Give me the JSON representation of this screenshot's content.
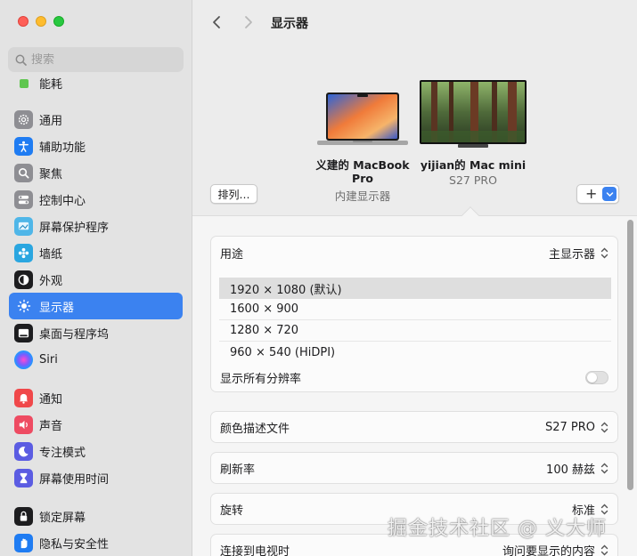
{
  "window": {
    "title": "显示器"
  },
  "sidebar": {
    "search_placeholder": "搜索",
    "items": [
      {
        "label": "能耗",
        "icon": "battery-icon",
        "color": "#5fc64f"
      },
      {
        "label": "通用",
        "icon": "gear-icon",
        "color": "#8e8e93"
      },
      {
        "label": "辅助功能",
        "icon": "accessibility-icon",
        "color": "#1f7cf2"
      },
      {
        "label": "聚焦",
        "icon": "magnifier-icon",
        "color": "#8e8e93"
      },
      {
        "label": "控制中心",
        "icon": "control-center-icon",
        "color": "#8e8e93"
      },
      {
        "label": "屏幕保护程序",
        "icon": "screensaver-icon",
        "color": "#4fb6e8"
      },
      {
        "label": "墙纸",
        "icon": "wallpaper-icon",
        "color": "#2aa6e0"
      },
      {
        "label": "外观",
        "icon": "appearance-icon",
        "color": "#1d1d1f"
      },
      {
        "label": "显示器",
        "icon": "display-icon",
        "color": "#3b82f0",
        "active": true
      },
      {
        "label": "桌面与程序坞",
        "icon": "dock-icon",
        "color": "#1d1d1f"
      },
      {
        "label": "Siri",
        "icon": "siri-icon",
        "color": "#2b2b2b"
      },
      {
        "label": "通知",
        "icon": "bell-icon",
        "color": "#f0484a"
      },
      {
        "label": "声音",
        "icon": "speaker-icon",
        "color": "#ee4b62"
      },
      {
        "label": "专注模式",
        "icon": "moon-icon",
        "color": "#5b5ce2"
      },
      {
        "label": "屏幕使用时间",
        "icon": "hourglass-icon",
        "color": "#5b5ce2"
      },
      {
        "label": "锁定屏幕",
        "icon": "lock-icon",
        "color": "#1d1d1f"
      },
      {
        "label": "隐私与安全性",
        "icon": "hand-icon",
        "color": "#1f7cf2"
      }
    ]
  },
  "displays": {
    "laptop": {
      "name": "义建的 MacBook Pro",
      "sub": "内建显示器"
    },
    "monitor": {
      "name": "yijian的 Mac mini",
      "sub": "S27 PRO"
    },
    "arrange_label": "排列…",
    "add_label": "+"
  },
  "settings": {
    "use_as": {
      "label": "用途",
      "value": "主显示器"
    },
    "resolutions": [
      {
        "label": "1920 × 1080 (默认)",
        "selected": true
      },
      {
        "label": "1600 × 900",
        "selected": false
      },
      {
        "label": "1280 × 720",
        "selected": false
      },
      {
        "label": "960 × 540 (HiDPI)",
        "selected": false
      }
    ],
    "show_all_label": "显示所有分辨率",
    "show_all_on": false,
    "color_profile": {
      "label": "颜色描述文件",
      "value": "S27 PRO"
    },
    "refresh_rate": {
      "label": "刷新率",
      "value": "100 赫兹"
    },
    "rotation": {
      "label": "旋转",
      "value": "标准"
    },
    "tv_connection": {
      "label": "连接到电视时",
      "value": "询问要显示的内容"
    }
  },
  "watermark": "掘金技术社区 @ 义大师",
  "colors": {
    "accent": "#3b82f0",
    "sidebar_bg": "#e3e3e3"
  }
}
